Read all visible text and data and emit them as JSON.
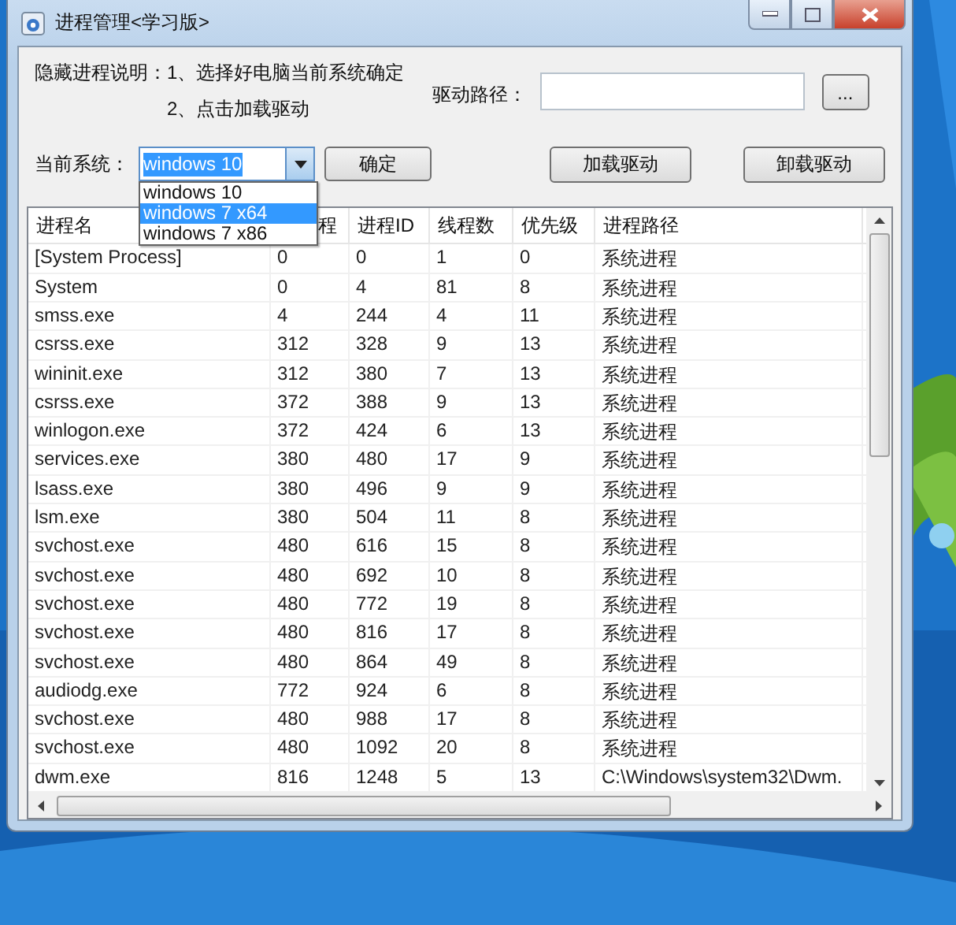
{
  "window": {
    "title": "进程管理<学习版>"
  },
  "instructions": {
    "label": "隐藏进程说明：",
    "lines": [
      "1、选择好电脑当前系统确定",
      "2、点击加载驱动"
    ]
  },
  "driver_path": {
    "label": "驱动路径：",
    "browse_button": "..."
  },
  "system": {
    "label": "当前系统：",
    "value": "windows 10",
    "dropdown_open": true,
    "options": [
      {
        "label": "windows 10",
        "highlighted": false
      },
      {
        "label": "windows 7 x64",
        "highlighted": true
      },
      {
        "label": "windows 7 x86",
        "highlighted": false
      }
    ]
  },
  "buttons": {
    "confirm": "确定",
    "load": "加载驱动",
    "unload": "卸载驱动"
  },
  "table": {
    "columns": [
      "进程名",
      "程",
      "进程ID",
      "线程数",
      "优先级",
      "进程路径"
    ],
    "rows": [
      [
        "[System Process]",
        "0",
        "0",
        "1",
        "0",
        "系统进程"
      ],
      [
        "System",
        "0",
        "4",
        "81",
        "8",
        "系统进程"
      ],
      [
        "smss.exe",
        "4",
        "244",
        "4",
        "11",
        "系统进程"
      ],
      [
        "csrss.exe",
        "312",
        "328",
        "9",
        "13",
        "系统进程"
      ],
      [
        "wininit.exe",
        "312",
        "380",
        "7",
        "13",
        "系统进程"
      ],
      [
        "csrss.exe",
        "372",
        "388",
        "9",
        "13",
        "系统进程"
      ],
      [
        "winlogon.exe",
        "372",
        "424",
        "6",
        "13",
        "系统进程"
      ],
      [
        "services.exe",
        "380",
        "480",
        "17",
        "9",
        "系统进程"
      ],
      [
        "lsass.exe",
        "380",
        "496",
        "9",
        "9",
        "系统进程"
      ],
      [
        "lsm.exe",
        "380",
        "504",
        "11",
        "8",
        "系统进程"
      ],
      [
        "svchost.exe",
        "480",
        "616",
        "15",
        "8",
        "系统进程"
      ],
      [
        "svchost.exe",
        "480",
        "692",
        "10",
        "8",
        "系统进程"
      ],
      [
        "svchost.exe",
        "480",
        "772",
        "19",
        "8",
        "系统进程"
      ],
      [
        "svchost.exe",
        "480",
        "816",
        "17",
        "8",
        "系统进程"
      ],
      [
        "svchost.exe",
        "480",
        "864",
        "49",
        "8",
        "系统进程"
      ],
      [
        "audiodg.exe",
        "772",
        "924",
        "6",
        "8",
        "系统进程"
      ],
      [
        "svchost.exe",
        "480",
        "988",
        "17",
        "8",
        "系统进程"
      ],
      [
        "svchost.exe",
        "480",
        "1092",
        "20",
        "8",
        "系统进程"
      ],
      [
        "dwm.exe",
        "816",
        "1248",
        "5",
        "13",
        "C:\\Windows\\system32\\Dwm."
      ]
    ]
  }
}
